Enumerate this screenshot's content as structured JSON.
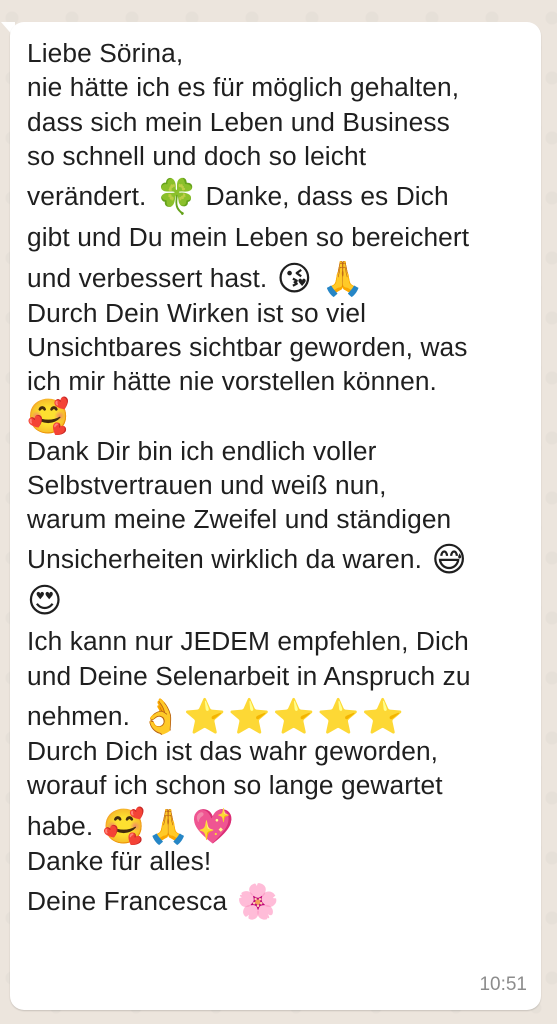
{
  "message": {
    "lines": [
      "Liebe Sörina,",
      "nie hätte ich es für möglich gehalten,",
      "dass sich mein Leben und Business",
      "so schnell und doch so leicht",
      "verändert.",
      "Danke, dass es Dich",
      "gibt und Du mein Leben so bereichert",
      "und verbessert hast.",
      "Durch Dein Wirken ist so viel",
      "Unsichtbares sichtbar geworden, was",
      "ich mir hätte nie vorstellen können.",
      "Dank Dir bin ich endlich voller",
      "Selbstvertrauen und weiß nun,",
      "warum meine Zweifel und ständigen",
      "Unsicherheiten wirklich da waren.",
      "Ich kann nur JEDEM empfehlen, Dich",
      "und Deine Selenarbeit in Anspruch zu",
      "nehmen.",
      "Durch Dich ist das wahr geworden,",
      "worauf ich schon so lange gewartet",
      "habe.",
      "Danke für alles!",
      "Deine Francesca"
    ],
    "emojis": {
      "clover": "🍀",
      "kiss": "😘",
      "pray": "🙏",
      "smiling_hearts": "🥰",
      "sweat_smile": "😅",
      "heart_eyes": "😍",
      "ok_hand": "👌",
      "star": "⭐",
      "sparkling_heart": "💖",
      "cherry_blossom": "🌸"
    },
    "time": "10:51"
  },
  "colors": {
    "background": "#ece5dd",
    "bubble": "#ffffff",
    "text": "#1f1f1f",
    "timestamp": "#8c8c8c"
  }
}
